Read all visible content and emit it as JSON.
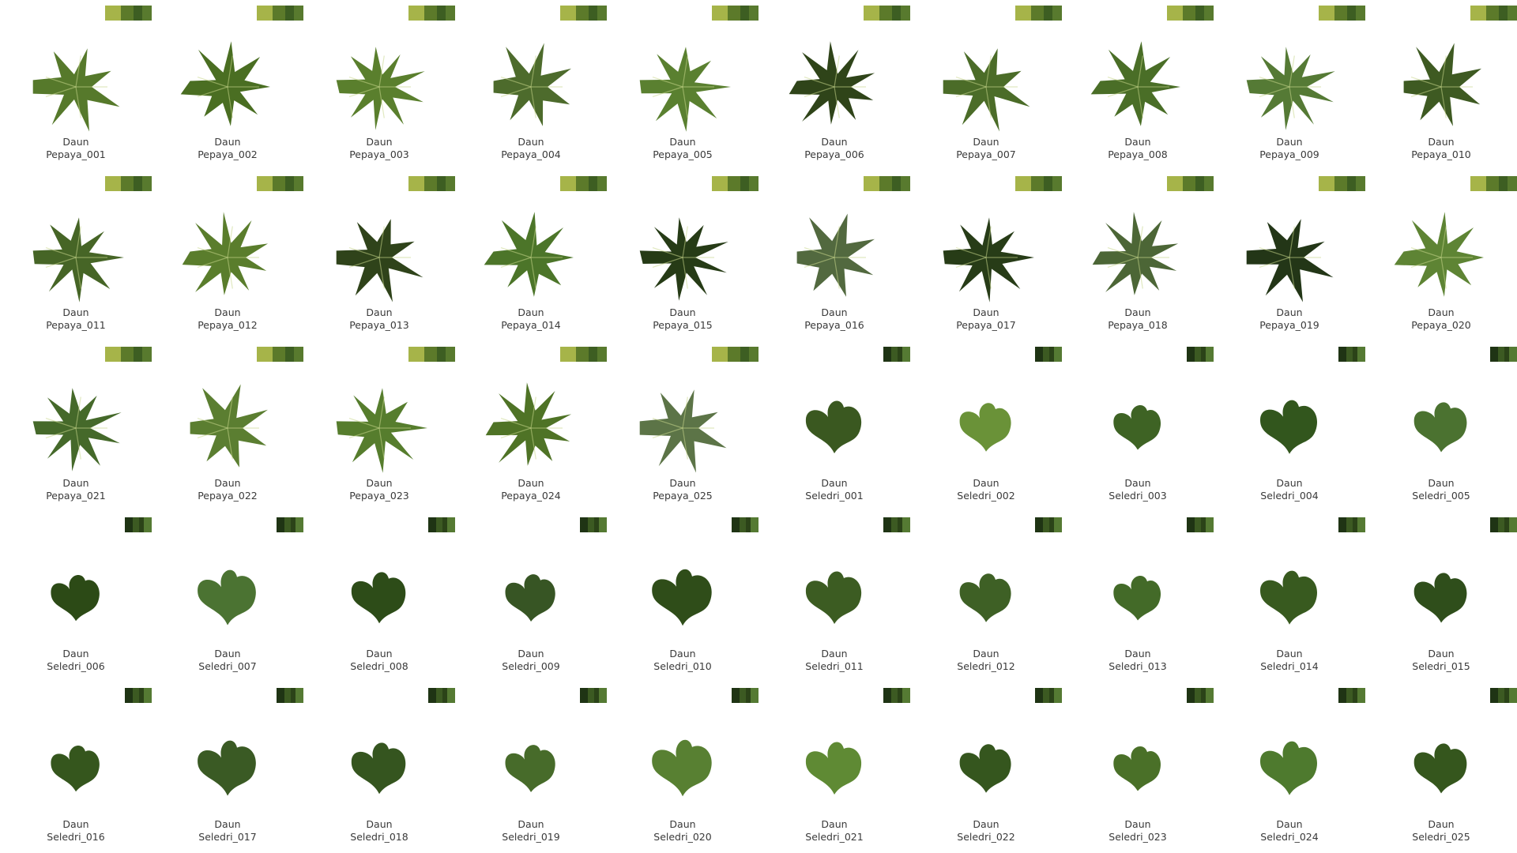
{
  "caption_prefix": "Daun",
  "colors": {
    "background": "#ffffff",
    "caption_text": "#3a3a3a"
  },
  "swatch_papaya": [
    "#a6b449",
    "#5c7a2a",
    "#3d5e22",
    "#587a2e"
  ],
  "swatch_seledri": [
    "#1f3414",
    "#3c5a22",
    "#2b4318",
    "#557a33"
  ],
  "leaves": [
    {
      "name": "Pepaya_001",
      "type": "papaya",
      "color": "#56792b"
    },
    {
      "name": "Pepaya_002",
      "type": "papaya",
      "color": "#4a6e22"
    },
    {
      "name": "Pepaya_003",
      "type": "papaya",
      "color": "#5a7f2d"
    },
    {
      "name": "Pepaya_004",
      "type": "papaya",
      "color": "#4d6b2c"
    },
    {
      "name": "Pepaya_005",
      "type": "papaya",
      "color": "#5a8030"
    },
    {
      "name": "Pepaya_006",
      "type": "papaya",
      "color": "#2f4419"
    },
    {
      "name": "Pepaya_007",
      "type": "papaya",
      "color": "#4b6c28"
    },
    {
      "name": "Pepaya_008",
      "type": "papaya",
      "color": "#4a6e27"
    },
    {
      "name": "Pepaya_009",
      "type": "papaya",
      "color": "#557a35"
    },
    {
      "name": "Pepaya_010",
      "type": "papaya",
      "color": "#3e5a22"
    },
    {
      "name": "Pepaya_011",
      "type": "papaya",
      "color": "#466526"
    },
    {
      "name": "Pepaya_012",
      "type": "papaya",
      "color": "#5a7d2c"
    },
    {
      "name": "Pepaya_013",
      "type": "papaya",
      "color": "#2f431a"
    },
    {
      "name": "Pepaya_014",
      "type": "papaya",
      "color": "#4c7529"
    },
    {
      "name": "Pepaya_015",
      "type": "papaya",
      "color": "#263b16"
    },
    {
      "name": "Pepaya_016",
      "type": "papaya",
      "color": "#52693f"
    },
    {
      "name": "Pepaya_017",
      "type": "papaya",
      "color": "#273c17"
    },
    {
      "name": "Pepaya_018",
      "type": "papaya",
      "color": "#4c6636"
    },
    {
      "name": "Pepaya_019",
      "type": "papaya",
      "color": "#233617"
    },
    {
      "name": "Pepaya_020",
      "type": "papaya",
      "color": "#5e8434"
    },
    {
      "name": "Pepaya_021",
      "type": "papaya",
      "color": "#45692a"
    },
    {
      "name": "Pepaya_022",
      "type": "papaya",
      "color": "#5b7e31"
    },
    {
      "name": "Pepaya_023",
      "type": "papaya",
      "color": "#567d2d"
    },
    {
      "name": "Pepaya_024",
      "type": "papaya",
      "color": "#4f7326"
    },
    {
      "name": "Pepaya_025",
      "type": "papaya",
      "color": "#5c7447"
    },
    {
      "name": "Seledri_001",
      "type": "seledri",
      "color": "#3a5820"
    },
    {
      "name": "Seledri_002",
      "type": "seledri",
      "color": "#6a9238"
    },
    {
      "name": "Seledri_003",
      "type": "seledri",
      "color": "#3e6324"
    },
    {
      "name": "Seledri_004",
      "type": "seledri",
      "color": "#32561d"
    },
    {
      "name": "Seledri_005",
      "type": "seledri",
      "color": "#4b7230"
    },
    {
      "name": "Seledri_006",
      "type": "seledri",
      "color": "#2c4a16"
    },
    {
      "name": "Seledri_007",
      "type": "seledri",
      "color": "#4b7332"
    },
    {
      "name": "Seledri_008",
      "type": "seledri",
      "color": "#2d4c18"
    },
    {
      "name": "Seledri_009",
      "type": "seledri",
      "color": "#375524"
    },
    {
      "name": "Seledri_010",
      "type": "seledri",
      "color": "#2f4d19"
    },
    {
      "name": "Seledri_011",
      "type": "seledri",
      "color": "#3c5c22"
    },
    {
      "name": "Seledri_012",
      "type": "seledri",
      "color": "#3e6025"
    },
    {
      "name": "Seledri_013",
      "type": "seledri",
      "color": "#436a28"
    },
    {
      "name": "Seledri_014",
      "type": "seledri",
      "color": "#385a1f"
    },
    {
      "name": "Seledri_015",
      "type": "seledri",
      "color": "#2f4e1b"
    },
    {
      "name": "Seledri_016",
      "type": "seledri",
      "color": "#35561d"
    },
    {
      "name": "Seledri_017",
      "type": "seledri",
      "color": "#3a5a24"
    },
    {
      "name": "Seledri_018",
      "type": "seledri",
      "color": "#35551f"
    },
    {
      "name": "Seledri_019",
      "type": "seledri",
      "color": "#476b2a"
    },
    {
      "name": "Seledri_020",
      "type": "seledri",
      "color": "#588032"
    },
    {
      "name": "Seledri_021",
      "type": "seledri",
      "color": "#5f8a34"
    },
    {
      "name": "Seledri_022",
      "type": "seledri",
      "color": "#35561e"
    },
    {
      "name": "Seledri_023",
      "type": "seledri",
      "color": "#4a7028"
    },
    {
      "name": "Seledri_024",
      "type": "seledri",
      "color": "#4e7a2e"
    },
    {
      "name": "Seledri_025",
      "type": "seledri",
      "color": "#35561d"
    }
  ]
}
